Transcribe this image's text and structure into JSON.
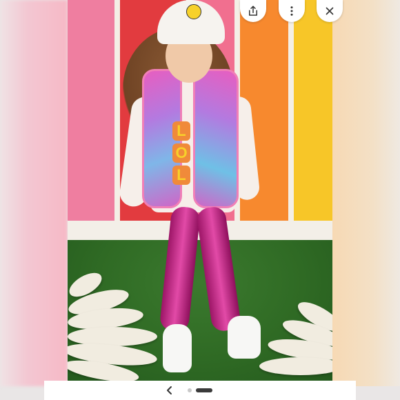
{
  "photo": {
    "alt_subject": "",
    "shirt_print": [
      "L",
      "O",
      "L"
    ]
  },
  "overlay_buttons": {
    "share_icon": "share-icon",
    "more_icon": "more-vertical-icon",
    "close_icon": "close-icon"
  },
  "carousel": {
    "prev_icon": "chevron-left-icon",
    "page_count": 2,
    "active_index": 1
  },
  "colors": {
    "active_dot": "#3a3a3a",
    "inactive_dot": "#c9c9c9",
    "bar_background": "#ffffff"
  }
}
